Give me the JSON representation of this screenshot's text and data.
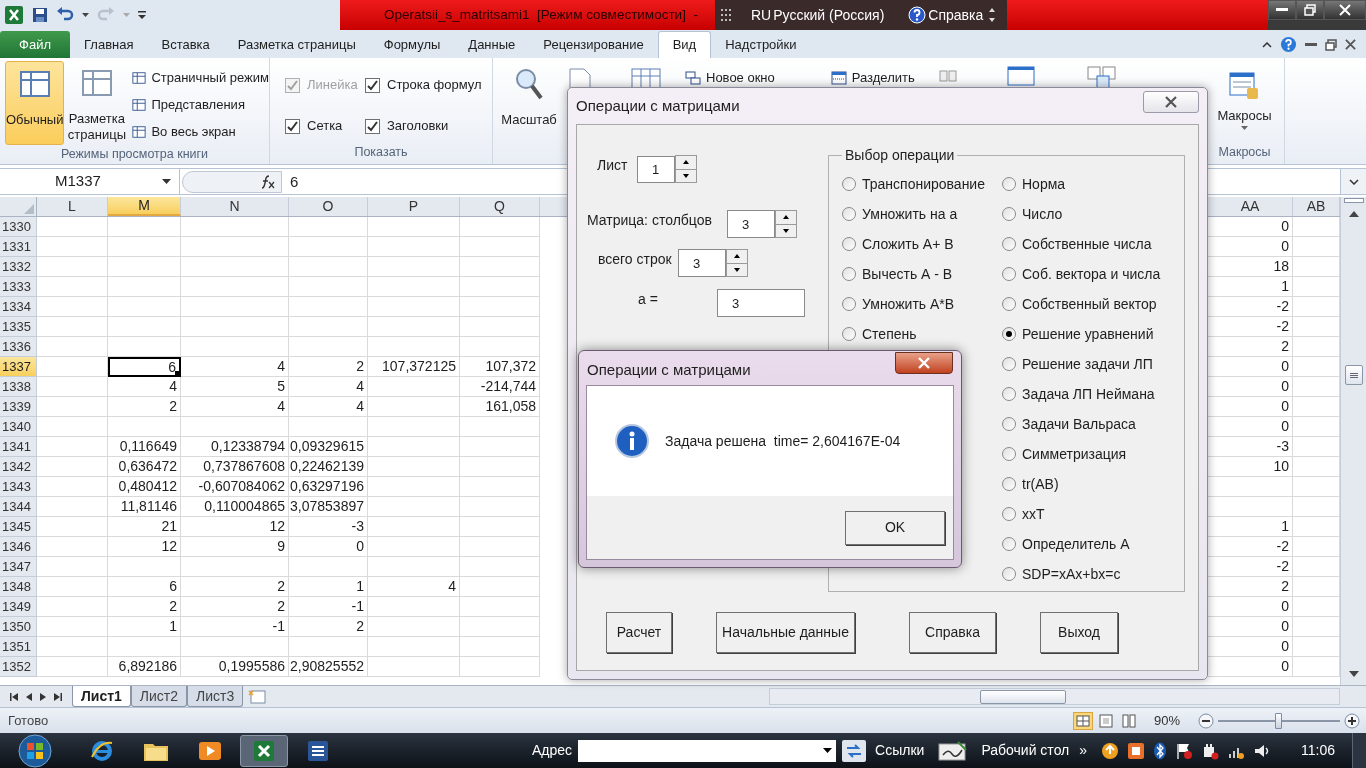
{
  "window": {
    "title": "Operatsii_s_matritsami1  [Режим совместимости]  -"
  },
  "language_bar": {
    "code": "RU",
    "language": "Русский (Россия)",
    "help": "Справка"
  },
  "ribbon_tabs": [
    {
      "label": "Файл",
      "kind": "file",
      "selected": false
    },
    {
      "label": "Главная",
      "kind": "tab",
      "selected": false
    },
    {
      "label": "Вставка",
      "kind": "tab",
      "selected": false
    },
    {
      "label": "Разметка страницы",
      "kind": "tab",
      "selected": false
    },
    {
      "label": "Формулы",
      "kind": "tab",
      "selected": false
    },
    {
      "label": "Данные",
      "kind": "tab",
      "selected": false
    },
    {
      "label": "Рецензирование",
      "kind": "tab",
      "selected": false
    },
    {
      "label": "Вид",
      "kind": "tab",
      "selected": true
    },
    {
      "label": "Надстройки",
      "kind": "tab",
      "selected": false
    }
  ],
  "view_modes": {
    "label": "Режимы просмотра книги",
    "large": [
      {
        "label": "Обычный",
        "selected": true
      },
      {
        "label": "Разметка страницы",
        "selected": false
      }
    ],
    "small": [
      "Страничный режим",
      "Представления",
      "Во весь экран"
    ]
  },
  "show": {
    "label": "Показать",
    "checks": [
      {
        "label": "Линейка",
        "checked": true,
        "disabled": true
      },
      {
        "label": "Строка формул",
        "checked": true,
        "disabled": false
      },
      {
        "label": "Сетка",
        "checked": true,
        "disabled": false
      },
      {
        "label": "Заголовки",
        "checked": true,
        "disabled": false
      }
    ]
  },
  "zoom": {
    "button": "Масштаб"
  },
  "window_group": {
    "items": [
      "Новое окно",
      "Разделить"
    ]
  },
  "macros": {
    "button": "Макросы",
    "label": "Макросы"
  },
  "formula_bar": {
    "name_box": "M1337",
    "value": "6"
  },
  "grid": {
    "columns": [
      {
        "label": "L",
        "selected": false
      },
      {
        "label": "M",
        "selected": true
      },
      {
        "label": "N",
        "selected": false
      },
      {
        "label": "O",
        "selected": false
      },
      {
        "label": "P",
        "selected": false
      },
      {
        "label": "Q",
        "selected": false
      },
      {
        "label": "AA",
        "selected": false
      },
      {
        "label": "AB",
        "selected": false
      }
    ],
    "rows": [
      {
        "label": "1330",
        "selected": false,
        "cells": [
          null,
          null,
          null,
          null,
          null,
          null,
          "0",
          null
        ]
      },
      {
        "label": "1331",
        "selected": false,
        "cells": [
          null,
          null,
          null,
          null,
          null,
          null,
          "0",
          null
        ]
      },
      {
        "label": "1332",
        "selected": false,
        "cells": [
          null,
          null,
          null,
          null,
          null,
          null,
          "18",
          null
        ]
      },
      {
        "label": "1333",
        "selected": false,
        "cells": [
          null,
          null,
          null,
          null,
          null,
          null,
          "1",
          null
        ]
      },
      {
        "label": "1334",
        "selected": false,
        "cells": [
          null,
          null,
          null,
          null,
          null,
          null,
          "-2",
          null
        ]
      },
      {
        "label": "1335",
        "selected": false,
        "cells": [
          null,
          null,
          null,
          null,
          null,
          null,
          "-2",
          null
        ]
      },
      {
        "label": "1336",
        "selected": false,
        "cells": [
          null,
          null,
          null,
          null,
          null,
          null,
          "2",
          null
        ]
      },
      {
        "label": "1337",
        "selected": true,
        "cells": [
          null,
          "6",
          "4",
          "2",
          "107,372125",
          "107,372",
          "0",
          null
        ]
      },
      {
        "label": "1338",
        "selected": false,
        "cells": [
          null,
          "4",
          "5",
          "4",
          null,
          "-214,744",
          "0",
          null
        ]
      },
      {
        "label": "1339",
        "selected": false,
        "cells": [
          null,
          "2",
          "4",
          "4",
          null,
          "161,058",
          "0",
          null
        ]
      },
      {
        "label": "1340",
        "selected": false,
        "cells": [
          null,
          null,
          null,
          null,
          null,
          null,
          "0",
          null
        ]
      },
      {
        "label": "1341",
        "selected": false,
        "cells": [
          null,
          "0,116649",
          "0,12338794",
          "0,09329615",
          null,
          null,
          "-3",
          null
        ]
      },
      {
        "label": "1342",
        "selected": false,
        "cells": [
          null,
          "0,636472",
          "0,737867608",
          "0,22462139",
          null,
          null,
          "10",
          null
        ]
      },
      {
        "label": "1343",
        "selected": false,
        "cells": [
          null,
          "0,480412",
          "-0,607084062",
          "0,63297196",
          null,
          null,
          null,
          null
        ]
      },
      {
        "label": "1344",
        "selected": false,
        "cells": [
          null,
          "11,81146",
          "0,110004865",
          "3,07853897",
          null,
          null,
          null,
          null
        ]
      },
      {
        "label": "1345",
        "selected": false,
        "cells": [
          null,
          "21",
          "12",
          "-3",
          null,
          null,
          "1",
          null
        ]
      },
      {
        "label": "1346",
        "selected": false,
        "cells": [
          null,
          "12",
          "9",
          "0",
          null,
          null,
          "-2",
          null
        ]
      },
      {
        "label": "1347",
        "selected": false,
        "cells": [
          null,
          null,
          null,
          null,
          null,
          null,
          "-2",
          null
        ]
      },
      {
        "label": "1348",
        "selected": false,
        "cells": [
          null,
          "6",
          "2",
          "1",
          "4",
          null,
          "2",
          null
        ]
      },
      {
        "label": "1349",
        "selected": false,
        "cells": [
          null,
          "2",
          "2",
          "-1",
          null,
          null,
          "0",
          null
        ]
      },
      {
        "label": "1350",
        "selected": false,
        "cells": [
          null,
          "1",
          "-1",
          "2",
          null,
          null,
          "0",
          null
        ]
      },
      {
        "label": "1351",
        "selected": false,
        "cells": [
          null,
          null,
          null,
          null,
          null,
          null,
          "0",
          null
        ]
      },
      {
        "label": "1352",
        "selected": false,
        "cells": [
          null,
          "6,892186",
          "0,1995586",
          "2,90825552",
          null,
          null,
          "0",
          null
        ]
      }
    ]
  },
  "sheet_tabs": [
    {
      "label": "Лист1",
      "selected": true
    },
    {
      "label": "Лист2",
      "selected": false
    },
    {
      "label": "Лист3",
      "selected": false
    }
  ],
  "status_bar": {
    "status": "Готово",
    "zoom": "90%",
    "level": 0.5
  },
  "dialog": {
    "title": "Операции с матрицами",
    "sheet": {
      "label": "Лист",
      "value": "1"
    },
    "columns": {
      "label": "Матрица: столбцов",
      "value": "3"
    },
    "rows": {
      "label": "всего строк",
      "value": "3"
    },
    "a": {
      "label": "а =",
      "value": "3"
    },
    "group": {
      "label": "Выбор операции",
      "left": [
        {
          "label": "Транспонирование",
          "selected": false
        },
        {
          "label": "Умножить на а",
          "selected": false
        },
        {
          "label": "Сложить А+ В",
          "selected": false
        },
        {
          "label": "Вычесть А - В",
          "selected": false
        },
        {
          "label": "Умножить А*В",
          "selected": false
        },
        {
          "label": "Степень",
          "selected": false
        }
      ],
      "right": [
        {
          "label": "Норма",
          "selected": false
        },
        {
          "label": "Число",
          "selected": false
        },
        {
          "label": "Собственные числа",
          "selected": false
        },
        {
          "label": "Соб. вектора и числа",
          "selected": false
        },
        {
          "label": "Собственный вектор",
          "selected": false
        },
        {
          "label": "Решение уравнений",
          "selected": true
        },
        {
          "label": "Решение задачи ЛП",
          "selected": false
        },
        {
          "label": "Задача ЛП Неймана",
          "selected": false
        },
        {
          "label": "Задачи Вальраса",
          "selected": false
        },
        {
          "label": "Симметризация",
          "selected": false
        },
        {
          "label": "tr(AB)",
          "selected": false
        },
        {
          "label": "xxT",
          "selected": false
        },
        {
          "label": "Определитель А",
          "selected": false
        },
        {
          "label": "SDP=xAx+bx=c",
          "selected": false
        }
      ]
    },
    "buttons": [
      "Расчет",
      "Начальные данные",
      "Справка",
      "Выход"
    ]
  },
  "message_box": {
    "title": "Операции с матрицами",
    "text": "Задача решена  time= 2,604167E-04",
    "button": "OK"
  },
  "taskbar": {
    "apps": [
      {
        "kind": "ie",
        "selected": false
      },
      {
        "kind": "folder",
        "selected": false
      },
      {
        "kind": "media",
        "selected": false
      },
      {
        "kind": "excel",
        "selected": true
      },
      {
        "kind": "word",
        "selected": false
      }
    ],
    "address_label": "Адрес",
    "links": "Ссылки",
    "desktop": "Рабочий стол",
    "more": "»",
    "clock": "11:06"
  }
}
